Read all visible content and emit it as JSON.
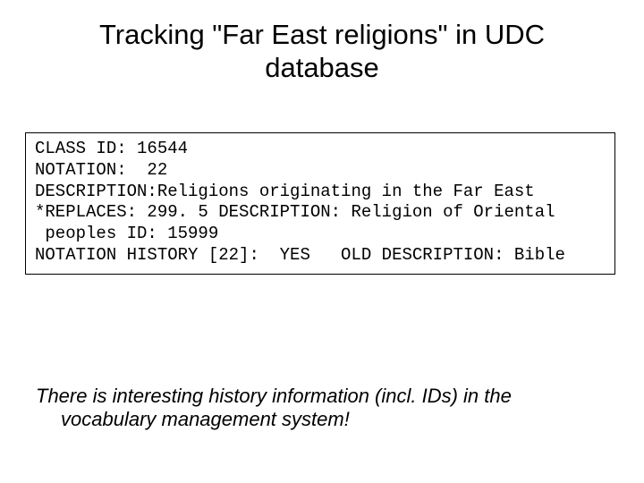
{
  "title": "Tracking \"Far East religions\" in UDC database",
  "record": {
    "line1": "CLASS ID: 16544",
    "line2": "NOTATION:  22",
    "line3": "DESCRIPTION:Religions originating in the Far East",
    "line4": "*REPLACES: 299. 5 DESCRIPTION: Religion of Oriental",
    "line5": " peoples ID: 15999",
    "line6": "NOTATION HISTORY [22]:  YES   OLD DESCRIPTION: Bible"
  },
  "note": "There is interesting history information (incl. IDs) in the vocabulary management system!"
}
